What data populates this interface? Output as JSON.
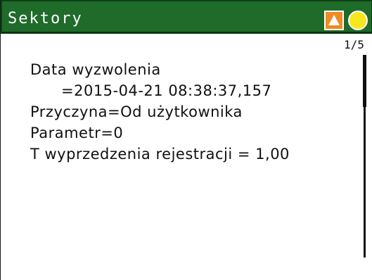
{
  "header": {
    "title": "Sektory",
    "status_icons": [
      {
        "name": "warning-icon",
        "color": "#f08a24"
      },
      {
        "name": "status-circle-icon",
        "color": "#f8e71c"
      }
    ]
  },
  "pager": {
    "label": "1/5"
  },
  "details": {
    "trigger_date_label": "Data wyzwolenia",
    "trigger_date_value": "=2015-04-21  08:38:37,157",
    "cause": "Przyczyna=Od użytkownika",
    "parameter": "Parametr=0",
    "pretrigger_time": "T wyprzedzenia rejestracji = 1,00"
  },
  "colors": {
    "titlebar": "#1f6b2a",
    "title_text": "#ffffff",
    "text": "#111111",
    "background": "#ffffff"
  }
}
